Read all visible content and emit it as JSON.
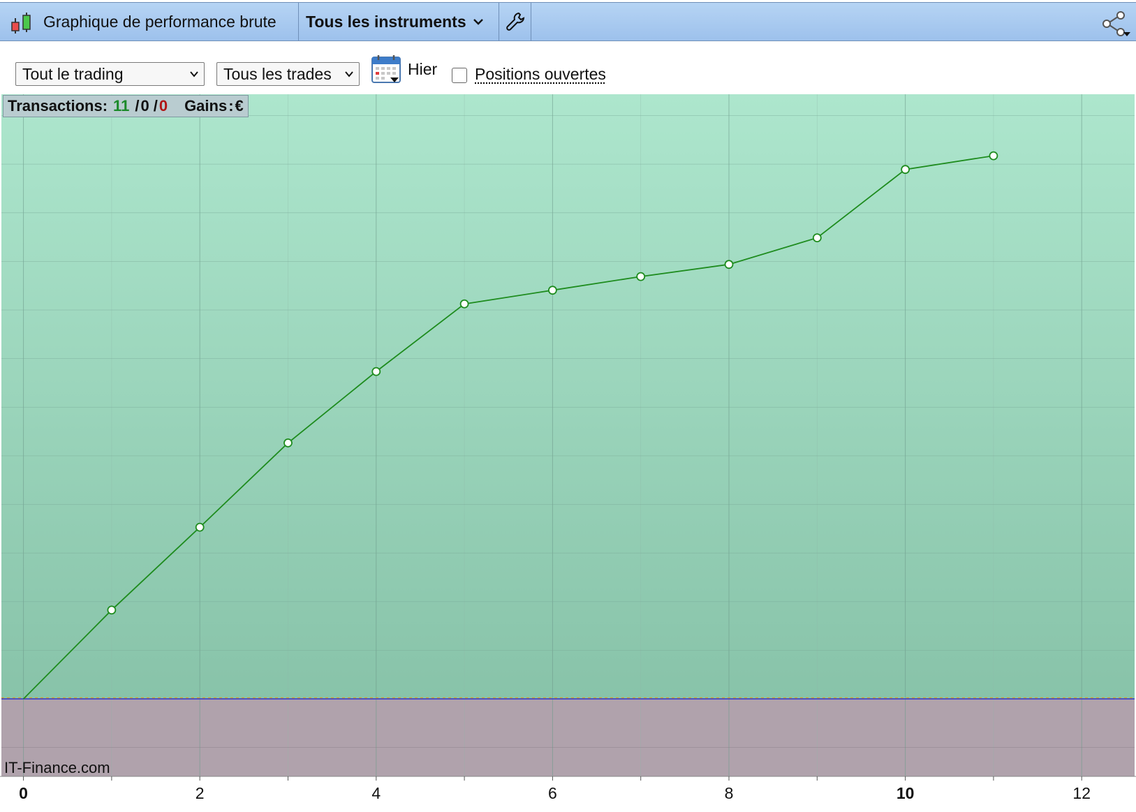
{
  "header": {
    "title": "Graphique de performance brute",
    "instruments": "Tous les instruments"
  },
  "toolbar": {
    "trading_select": "Tout le trading",
    "trades_select": "Tous les trades",
    "period": "Hier",
    "open_positions_label": "Positions ouvertes",
    "open_positions_checked": false
  },
  "stats": {
    "transactions_label": "Transactions:",
    "winning": "11",
    "neutral": "0",
    "losing": "0",
    "gains_label": "Gains",
    "gains_value": "€"
  },
  "watermark": "IT-Finance.com",
  "colors": {
    "line": "#1e8c1e",
    "profit_zone": "#a8e4cc",
    "loss_zone": "#b0a2ac",
    "baseline": "#3333cc"
  },
  "chart_data": {
    "type": "line",
    "x": [
      0,
      1,
      2,
      3,
      4,
      5,
      6,
      7,
      8,
      9,
      10,
      11
    ],
    "y": [
      0,
      117,
      226,
      337,
      431,
      520,
      538,
      556,
      572,
      607,
      697,
      715
    ],
    "xlim": [
      -0.25,
      12.6
    ],
    "ylim": [
      -102,
      796
    ],
    "x_ticks": [
      0,
      2,
      4,
      6,
      8,
      10,
      12
    ],
    "x_tick_labels": [
      "0",
      "2",
      "4",
      "6",
      "8",
      "10",
      "12"
    ],
    "bold_ticks": [
      "0",
      "10"
    ],
    "grid": true
  }
}
